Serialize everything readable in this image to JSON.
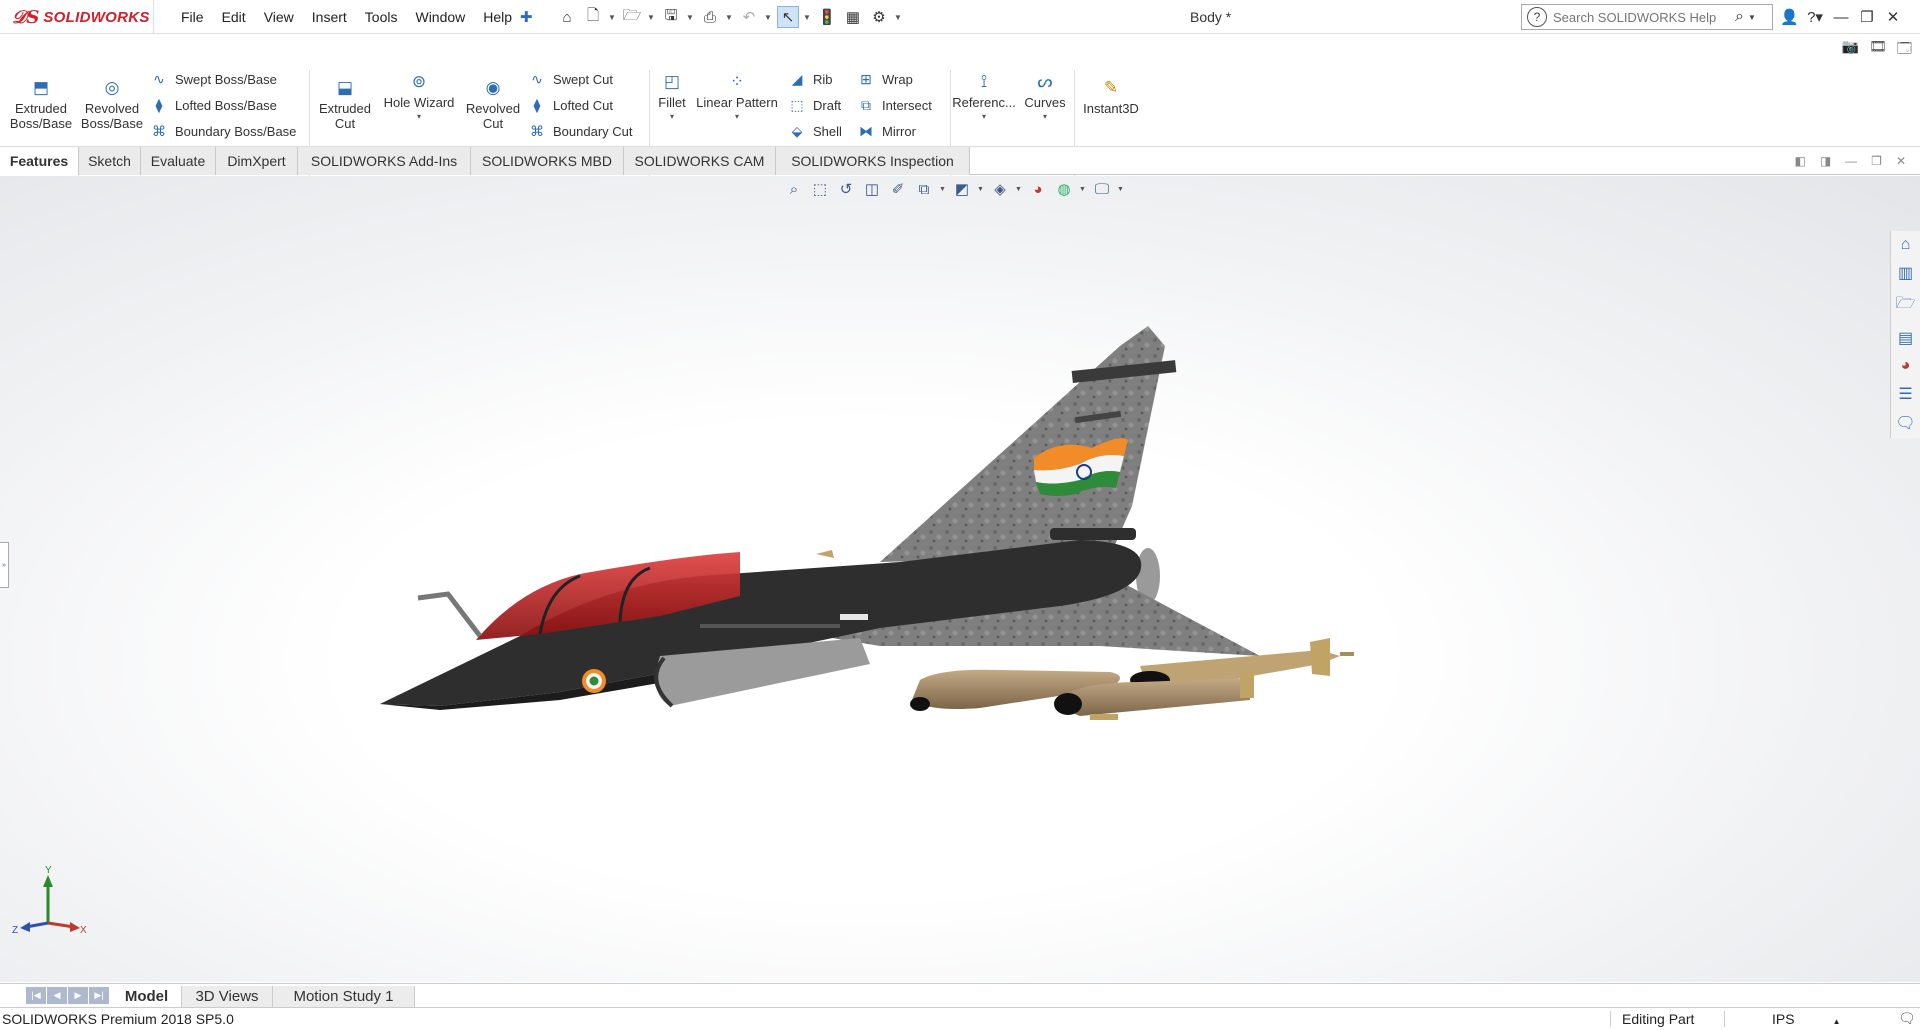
{
  "app": {
    "brand": "SOLIDWORKS",
    "document_title": "Body *"
  },
  "menu": [
    "File",
    "Edit",
    "View",
    "Insert",
    "Tools",
    "Window",
    "Help"
  ],
  "search": {
    "placeholder": "Search SOLIDWORKS Help"
  },
  "ribbon": {
    "extruded_boss": [
      "Extruded",
      "Boss/Base"
    ],
    "revolved_boss": [
      "Revolved",
      "Boss/Base"
    ],
    "swept_boss": "Swept Boss/Base",
    "lofted_boss": "Lofted Boss/Base",
    "boundary_boss": "Boundary Boss/Base",
    "extruded_cut": [
      "Extruded",
      "Cut"
    ],
    "hole_wizard": "Hole Wizard",
    "revolved_cut": [
      "Revolved",
      "Cut"
    ],
    "swept_cut": "Swept Cut",
    "lofted_cut": "Lofted Cut",
    "boundary_cut": "Boundary Cut",
    "fillet": "Fillet",
    "linear_pattern": "Linear Pattern",
    "rib": "Rib",
    "draft": "Draft",
    "shell": "Shell",
    "wrap": "Wrap",
    "intersect": "Intersect",
    "mirror": "Mirror",
    "reference": "Referenc...",
    "curves": "Curves",
    "instant3d": "Instant3D"
  },
  "tabs": [
    "Features",
    "Sketch",
    "Evaluate",
    "DimXpert",
    "SOLIDWORKS Add-Ins",
    "SOLIDWORKS MBD",
    "SOLIDWORKS CAM",
    "SOLIDWORKS Inspection"
  ],
  "active_tab": "Features",
  "triad": {
    "x": "X",
    "y": "Y",
    "z": "Z"
  },
  "bottom_tabs": [
    "Model",
    "3D Views",
    "Motion Study 1"
  ],
  "status": {
    "product": "SOLIDWORKS Premium 2018 SP5.0",
    "mode": "Editing Part",
    "units": "IPS"
  },
  "icons": {
    "logo": "ds-logo-icon",
    "pin": "pin-icon",
    "colors": {
      "brand_red": "#d0202a",
      "accent_blue": "#2f6db3"
    }
  }
}
